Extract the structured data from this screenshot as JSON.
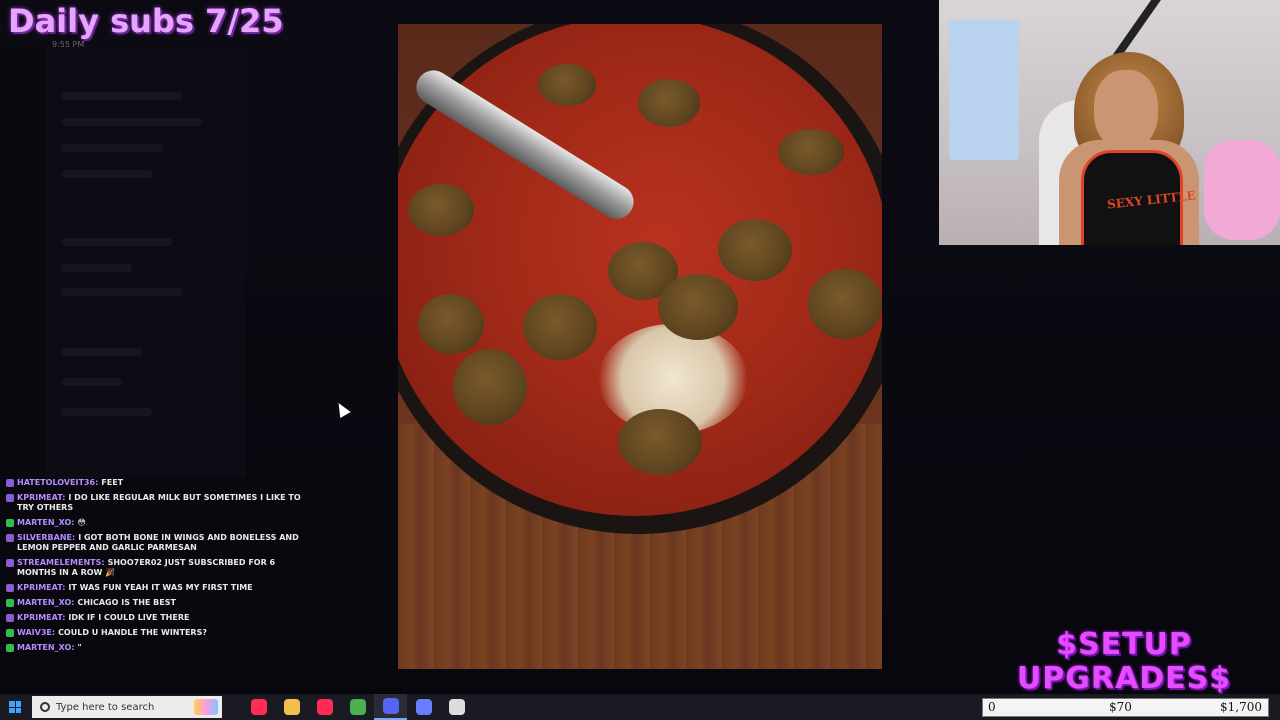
{
  "overlay": {
    "title": "Daily subs 7/25",
    "time": "9:55 PM",
    "goal_title": "$SETUP UPGRADES$",
    "goal_start": "0",
    "goal_current": "$70",
    "goal_target": "$1,700"
  },
  "chat": [
    {
      "badge": "purple",
      "user": "hatetoloveit36:",
      "msg": "feet"
    },
    {
      "badge": "purple",
      "user": "kprimeat:",
      "msg": "I do like regular milk but sometimes I like to try others"
    },
    {
      "badge": "green",
      "user": "marten_xo:",
      "msg": "😳"
    },
    {
      "badge": "purple",
      "user": "silverbane:",
      "msg": "I got both bone in wings and boneless and lemon pepper and garlic parmesan"
    },
    {
      "badge": "purple",
      "user": "streamelements:",
      "msg": "shoo7er02 just subscribed for 6 months in a row 🎉"
    },
    {
      "badge": "purple",
      "user": "kprimeat:",
      "msg": "it was fun yeah it was my first time"
    },
    {
      "badge": "green",
      "user": "marten_xo:",
      "msg": "chicago is the best"
    },
    {
      "badge": "purple",
      "user": "kprimeat:",
      "msg": "idk if I could live there"
    },
    {
      "badge": "green",
      "user": "waiv3e:",
      "msg": "could u handle the winters?"
    },
    {
      "badge": "green",
      "user": "marten_xo:",
      "msg": "\""
    }
  ],
  "webcam": {
    "tank_text": "SEXY LITTLE"
  },
  "taskbar": {
    "search_placeholder": "Type here to search",
    "apps": [
      {
        "name": "music-app-icon",
        "color": "#ff2d55"
      },
      {
        "name": "file-explorer-icon",
        "color": "#f3c14b"
      },
      {
        "name": "tiktok-icon",
        "color": "#fe2c55"
      },
      {
        "name": "chrome-icon",
        "color": "#4caf50"
      },
      {
        "name": "discord-icon",
        "color": "#5865f2"
      },
      {
        "name": "calendar-app-icon",
        "color": "#6a7cff"
      },
      {
        "name": "obs-icon",
        "color": "#dddddd"
      }
    ]
  }
}
